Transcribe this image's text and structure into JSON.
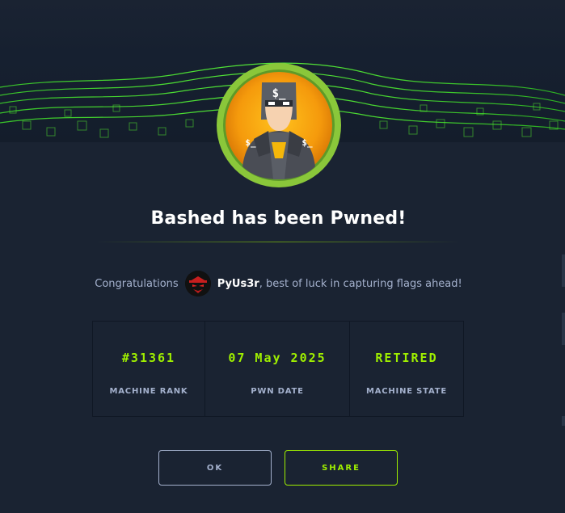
{
  "modal": {
    "title": "Bashed has been Pwned!",
    "congrats_prefix": "Congratulations",
    "username": "PyUs3r",
    "congrats_suffix": ", best of luck in capturing flags ahead!"
  },
  "stats": [
    {
      "value": "#31361",
      "label": "MACHINE RANK"
    },
    {
      "value": "07 May 2025",
      "label": "PWN DATE"
    },
    {
      "value": "RETIRED",
      "label": "MACHINE STATE"
    }
  ],
  "buttons": {
    "ok": "OK",
    "share": "SHARE"
  },
  "icons": {
    "badge": "machine-avatar-icon",
    "user": "user-avatar-icon"
  },
  "colors": {
    "background": "#1a2332",
    "accent": "#9fef00",
    "muted_text": "#a4b1cd"
  }
}
